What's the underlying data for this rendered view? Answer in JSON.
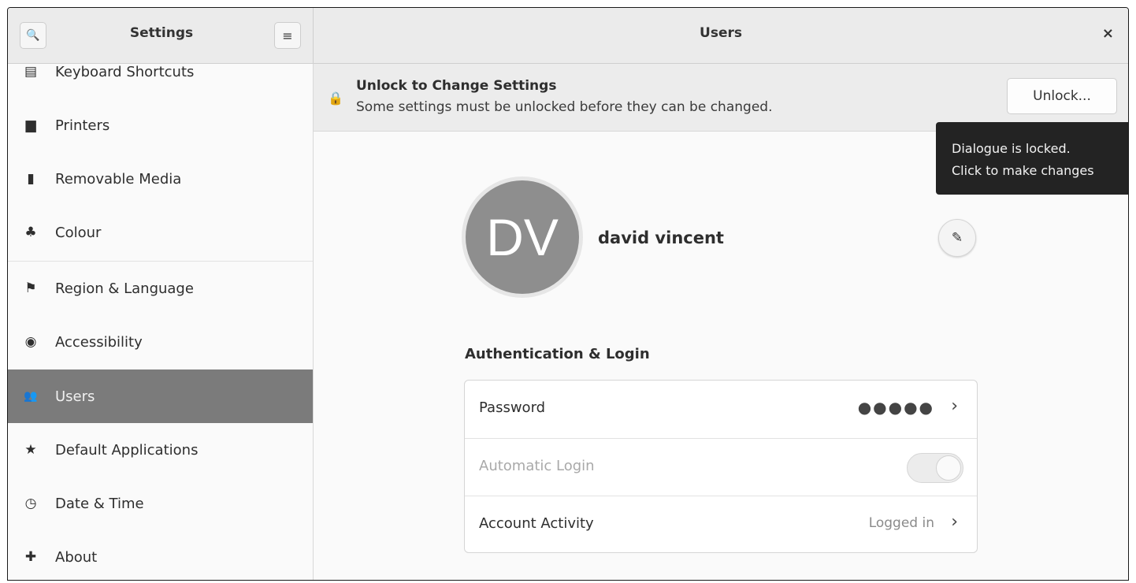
{
  "header": {
    "sidebar_title": "Settings",
    "page_title": "Users",
    "search_icon": "search-icon",
    "menu_icon": "hamburger-menu-icon",
    "close_icon": "close-icon",
    "search_glyph": "🔍",
    "menu_glyph": "≡",
    "close_glyph": "×"
  },
  "sidebar": {
    "items": [
      {
        "label": "Keyboard Shortcuts",
        "icon": "keyboard-icon",
        "glyph": "▤"
      },
      {
        "label": "Printers",
        "icon": "printer-icon",
        "glyph": "▆"
      },
      {
        "label": "Removable Media",
        "icon": "usb-drive-icon",
        "glyph": "▮"
      },
      {
        "label": "Colour",
        "icon": "colour-icon",
        "glyph": "♣"
      },
      {
        "label": "Region & Language",
        "icon": "flag-icon",
        "glyph": "⚑"
      },
      {
        "label": "Accessibility",
        "icon": "accessibility-icon",
        "glyph": "◉"
      },
      {
        "label": "Users",
        "icon": "users-icon",
        "glyph": "👥",
        "selected": true
      },
      {
        "label": "Default Applications",
        "icon": "star-icon",
        "glyph": "★"
      },
      {
        "label": "Date & Time",
        "icon": "clock-icon",
        "glyph": "◷"
      },
      {
        "label": "About",
        "icon": "about-icon",
        "glyph": "✚"
      }
    ]
  },
  "infobar": {
    "title": "Unlock to Change Settings",
    "subtitle": "Some settings must be unlocked before they can be changed.",
    "unlock_label": "Unlock...",
    "lock_glyph": "🔒"
  },
  "tooltip": {
    "line1": "Dialogue is locked.",
    "line2": "Click to make changes"
  },
  "user": {
    "initials": "DV",
    "name": "david vincent",
    "edit_glyph": "✎"
  },
  "auth": {
    "section_title": "Authentication & Login",
    "password_label": "Password",
    "password_value": "●●●●●",
    "autologin_label": "Automatic Login",
    "autologin_enabled": false,
    "activity_label": "Account Activity",
    "activity_value": "Logged in",
    "chevron_glyph": "›"
  },
  "colors": {
    "selected_bg": "#7b7b7b",
    "tooltip_bg": "#232323",
    "avatar_bg": "#8e8e8e"
  }
}
